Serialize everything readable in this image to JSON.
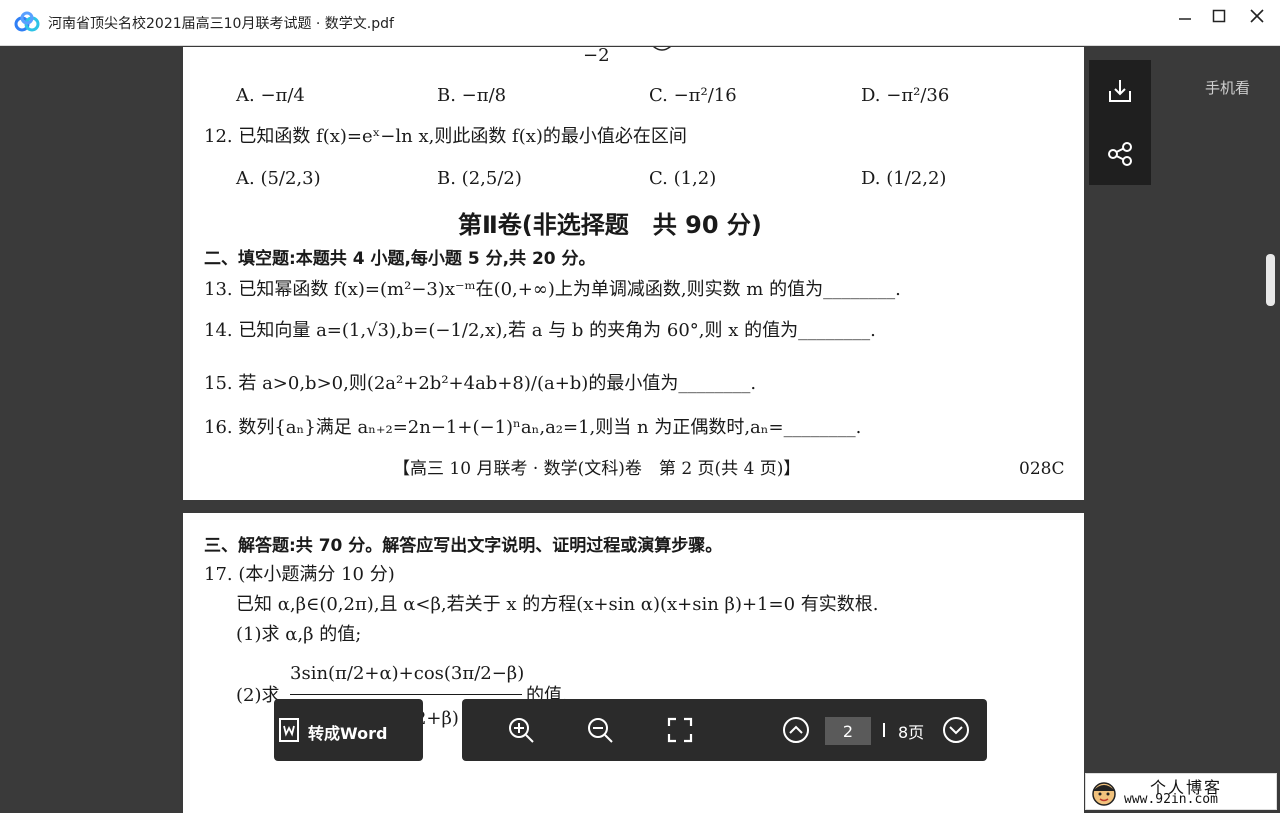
{
  "window": {
    "title": "河南省顶尖名校2021届高三10月联考试题 · 数学文.pdf"
  },
  "page1": {
    "top_fragment": "−2",
    "q11_options": [
      "A. −π/4",
      "B. −π/8",
      "C. −π²/16",
      "D. −π²/36"
    ],
    "q12": "12. 已知函数 f(x)=eˣ−ln x,则此函数 f(x)的最小值必在区间",
    "q12_options": [
      "A. (5/2,3)",
      "B. (2,5/2)",
      "C. (1,2)",
      "D. (1/2,2)"
    ],
    "section_heading": "第Ⅱ卷(非选择题　共 90 分)",
    "fill_in_title": "二、填空题:本题共 4 小题,每小题 5 分,共 20 分。",
    "q13": "13. 已知幂函数 f(x)=(m²−3)x⁻ᵐ在(0,+∞)上为单调减函数,则实数 m 的值为________.",
    "q14": "14. 已知向量 a=(1,√3),b=(−1/2,x),若 a 与 b 的夹角为 60°,则 x 的值为________.",
    "q15": "15. 若 a>0,b>0,则(2a²+2b²+4ab+8)/(a+b)的最小值为________.",
    "q16": "16. 数列{aₙ}满足 aₙ₊₂=2n−1+(−1)ⁿaₙ,a₂=1,则当 n 为正偶数时,aₙ=________.",
    "footer": "【高三 10 月联考 · 数学(文科)卷　第 2 页(共 4 页)】",
    "footer_code": "028C"
  },
  "page2": {
    "answer_title": "三、解答题:共 70 分。解答应写出文字说明、证明过程或演算步骤。",
    "q17": "17. (本小题满分 10 分)",
    "q17_body": "已知 α,β∈(0,2π),且 α<β,若关于 x 的方程(x+sin α)(x+sin β)+1=0 有实数根.",
    "q17_part1": "(1)求 α,β 的值;",
    "q17_part2_numer": "3sin(π/2+α)+cos(3π/2−β)",
    "q17_part2_prefix": "(2)求",
    "q17_part2_suffix": "的值.",
    "q17_part2_denom": "2      (−α)cos(3π/2+β)"
  },
  "right_panel": {
    "mobile_label": "手机看"
  },
  "word_button": {
    "label": "转成Word"
  },
  "toolbar": {
    "current_page": "2",
    "total_pages": "8页"
  },
  "watermark": {
    "line1": "个人博客",
    "line2": "www.92in.com"
  }
}
